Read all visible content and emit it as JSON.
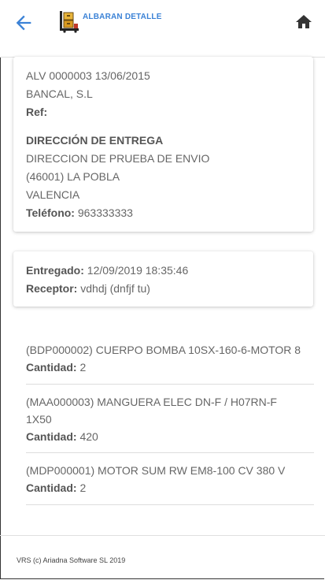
{
  "header": {
    "title": "ALBARAN DETALLE",
    "back_icon": "arrow-left-icon",
    "home_icon": "home-icon",
    "accent_color": "#3b82d6"
  },
  "delivery_note": {
    "code_date": "ALV 0000003 13/06/2015",
    "customer": "BANCAL, S.L",
    "ref_label": "Ref:",
    "address_heading": "DIRECCIÓN DE ENTREGA",
    "address_line1": "DIRECCION DE PRUEBA DE ENVIO",
    "address_line2": "(46001) LA POBLA",
    "address_line3": "VALENCIA",
    "phone_label": "Teléfono:",
    "phone_value": "963333333"
  },
  "delivery_status": {
    "delivered_label": "Entregado:",
    "delivered_value": "12/09/2019 18:35:46",
    "receiver_label": "Receptor:",
    "receiver_value": "vdhdj (dnfjf tu)"
  },
  "items": [
    {
      "name": "(BDP000002) CUERPO BOMBA 10SX-160-6-MOTOR 8",
      "qty_label": "Cantidad:",
      "qty": "2"
    },
    {
      "name": "(MAA000003) MANGUERA ELEC DN-F / H07RN-F 1X50",
      "qty_label": "Cantidad:",
      "qty": "420"
    },
    {
      "name": "(MDP000001) MOTOR SUM RW EM8-100 CV 380 V",
      "qty_label": "Cantidad:",
      "qty": "2"
    }
  ],
  "footer": {
    "copyright": "VRS (c) Ariadna Software SL 2019"
  }
}
